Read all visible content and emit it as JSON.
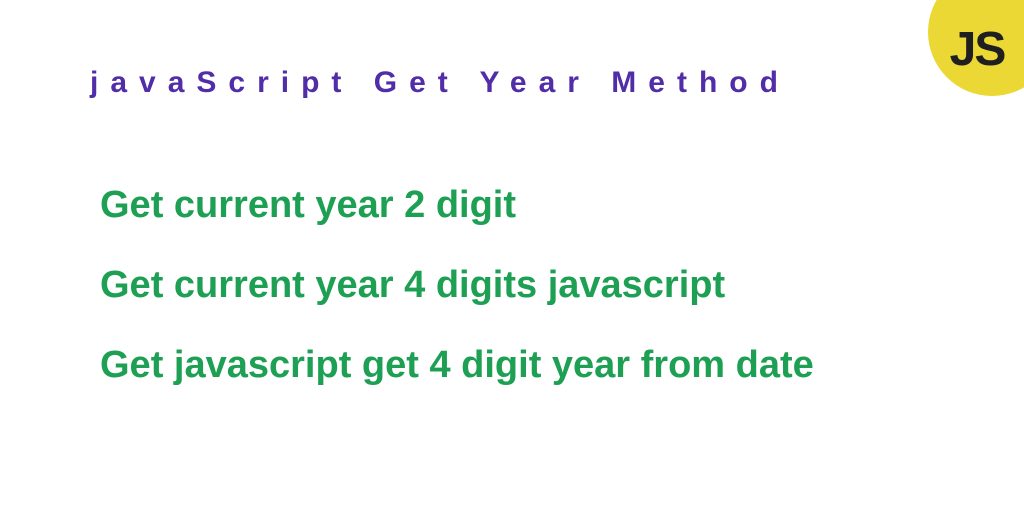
{
  "badge": {
    "label": "JS"
  },
  "title": "javaScript Get Year Method",
  "items": [
    "Get current year 2 digit",
    "Get current year 4 digits javascript",
    "Get javascript get 4 digit year from date"
  ],
  "colors": {
    "titleColor": "#512da8",
    "accentColor": "#1da053",
    "badgeBg": "#ebd834"
  }
}
